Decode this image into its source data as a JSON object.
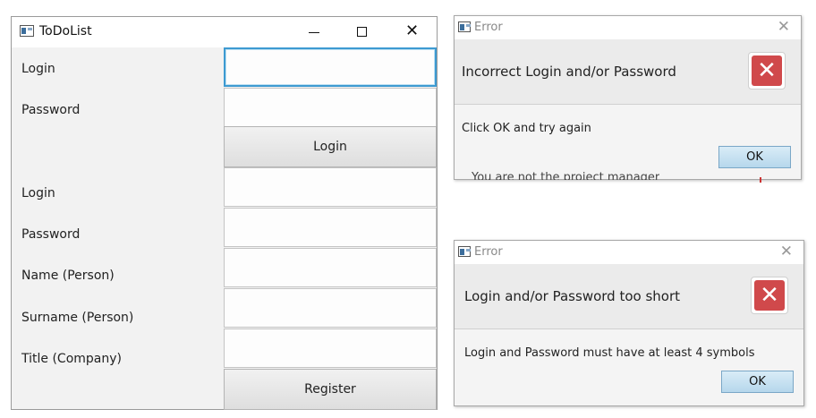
{
  "main_window": {
    "title": "ToDoList",
    "login_section": {
      "login_label": "Login",
      "password_label": "Password",
      "login_button": "Login"
    },
    "register_section": {
      "login_label": "Login",
      "password_label": "Password",
      "name_label": "Name (Person)",
      "surname_label": "Surname (Person)",
      "title_label": "Title (Company)",
      "register_button": "Register"
    }
  },
  "dialog_1": {
    "title": "Error",
    "header": "Incorrect Login and/or Password",
    "content": "Click OK and try again",
    "ok_button": "OK"
  },
  "dialog_2": {
    "title": "Error",
    "header": "Login and/or Password too short",
    "content": "Login and Password must have at least 4 symbols",
    "ok_button": "OK"
  },
  "background_peek_text": "You are not the project manager",
  "icons": {
    "app": "app-window-icon",
    "minimize": "minimize-icon",
    "maximize": "maximize-icon",
    "close": "close-icon",
    "error": "error-x-icon"
  },
  "colors": {
    "focus_border": "#3d9ad1",
    "error_icon": "#d0494b",
    "ok_button": "#b6d7ec"
  }
}
